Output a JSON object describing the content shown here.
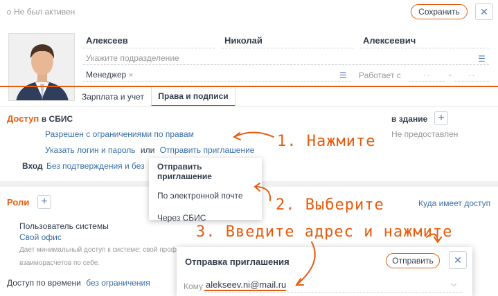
{
  "header": {
    "status_text": "Не был активен",
    "save_label": "Сохранить",
    "close_glyph": "✕"
  },
  "profile": {
    "last_name": "Алексеев",
    "first_name": "Николай",
    "patronymic": "Алексеевич",
    "department_placeholder": "Укажите подразделение",
    "position": "Менеджер",
    "works_since_label": "Работает с",
    "date_placeholder": ". .",
    "date_placeholder_2": ". ."
  },
  "tabs": [
    {
      "label": "Зарплата и учет",
      "active": false
    },
    {
      "label": "Права и подписи",
      "active": true
    }
  ],
  "access": {
    "title_prefix": "Доступ",
    "title_suffix": "в СБИС",
    "permission_link": "Разрешен с ограничениями по правам",
    "login_link": "Указать логин и пароль",
    "or_text": "или",
    "invite_link": "Отправить приглашение",
    "login_label": "Вход",
    "login_mode": "Без подтверждения и без",
    "building_label": "в здание",
    "building_value": "Не предоставлен"
  },
  "invite_menu": {
    "title": "Отправить приглашение",
    "items": [
      "По электронной почте",
      "Через СБИС"
    ]
  },
  "roles": {
    "title": "Роли",
    "access_link": "Куда имеет доступ",
    "role_name": "Пользователь системы",
    "office": "Свой офис",
    "description_1": "Дает минимальный доступ к системе: свой проф",
    "description_2": "взаиморасчетов по себе."
  },
  "time_access": {
    "label": "Доступ по времени",
    "value": "без ограничения"
  },
  "dialog": {
    "title": "Отправка приглашения",
    "send_label": "Отправить",
    "to_label": "Кому",
    "email": "alekseev.ni@mail.ru"
  },
  "annotations": {
    "step1": "1. Нажмите",
    "step2": "2. Выберите",
    "step3": "3. Введите адрес и нажмите"
  },
  "colors": {
    "accent": "#e65b0c",
    "link": "#3a6ea5",
    "tab_active": "#3a6ea5"
  }
}
